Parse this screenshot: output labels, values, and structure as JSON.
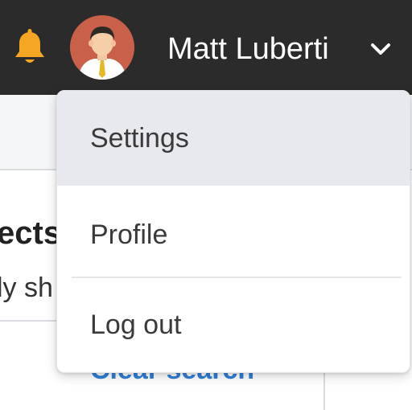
{
  "header": {
    "user_name": "Matt Luberti",
    "icons": {
      "bell": "bell-icon",
      "avatar": "user-avatar",
      "chevron": "chevron-down-icon"
    },
    "colors": {
      "background": "#2b2b2b",
      "bell": "#f5a623",
      "avatar_bg": "#c8604a",
      "text": "#ffffff"
    }
  },
  "user_menu": {
    "items": [
      {
        "label": "Settings",
        "highlighted": true
      },
      {
        "label": "Profile",
        "highlighted": false
      },
      {
        "label": "Log out",
        "highlighted": false
      }
    ]
  },
  "background": {
    "heading_fragment": "ects",
    "subtext_fragment": "ly sh",
    "link_label": "Clear search",
    "link_color": "#2f7fd8"
  }
}
